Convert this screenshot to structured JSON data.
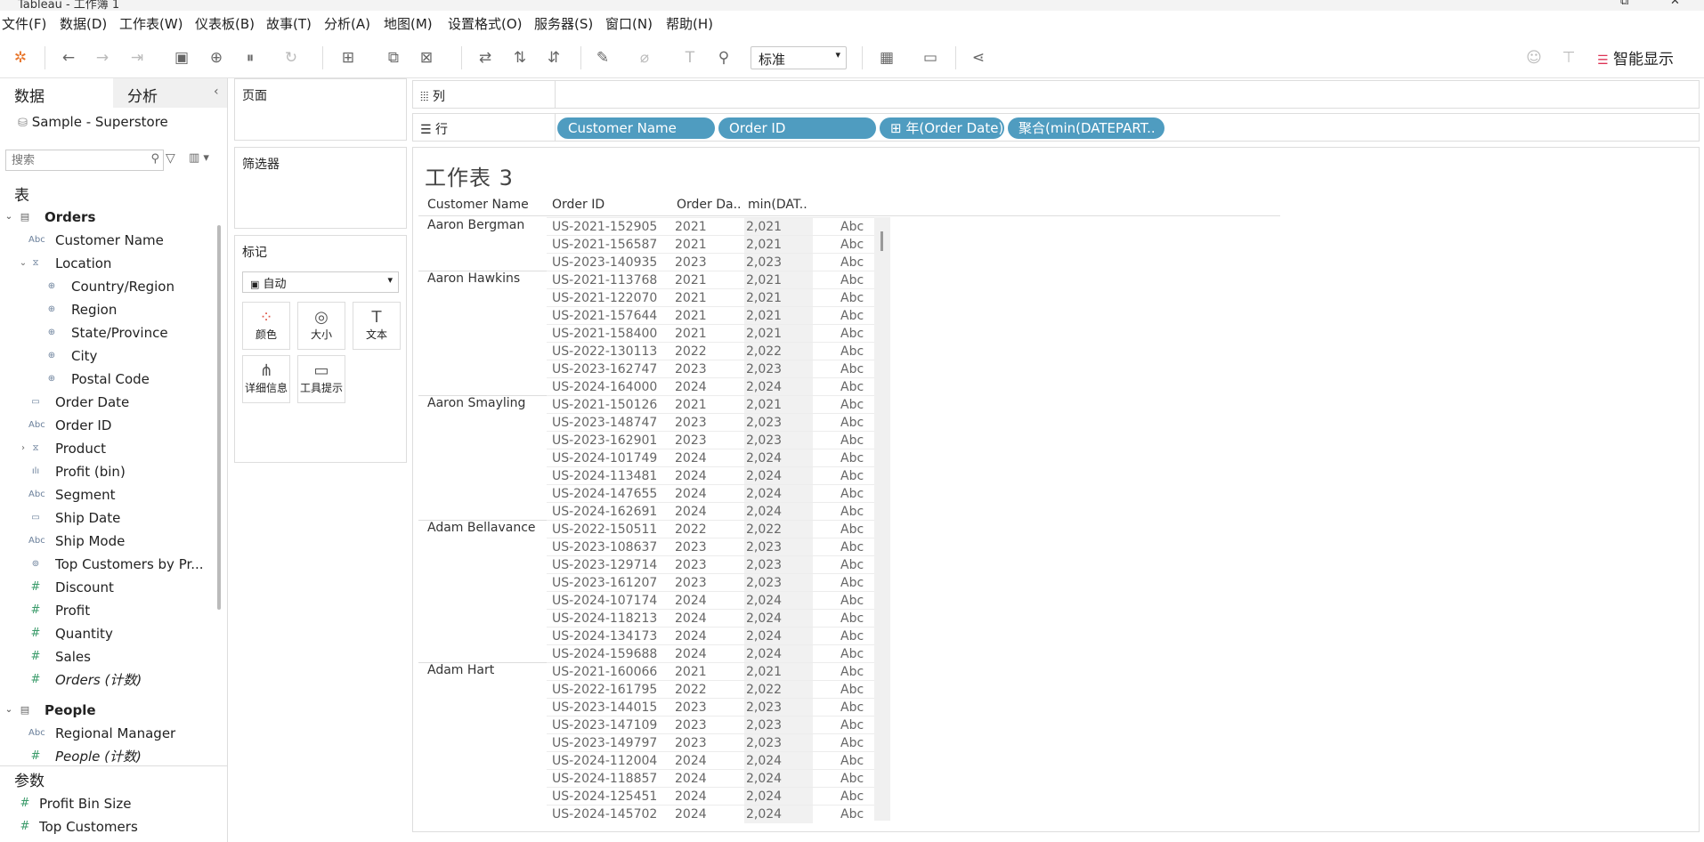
{
  "title": "Tableau - 工作簿 1",
  "menu": [
    "文件(F)",
    "数据(D)",
    "工作表(W)",
    "仪表板(B)",
    "故事(T)",
    "分析(A)",
    "地图(M)",
    "设置格式(O)",
    "服务器(S)",
    "窗口(N)",
    "帮助(H)"
  ],
  "toolbar": {
    "fit_select": "标准",
    "show_me": "智能显示"
  },
  "left_panel": {
    "tab_data": "数据",
    "tab_analysis": "分析",
    "datasource": "Sample - Superstore",
    "search_placeholder": "搜索",
    "tables_header": "表",
    "fields": [
      {
        "label": "Orders",
        "icon": "table-icon",
        "indent": 0,
        "group": true
      },
      {
        "label": "Customer Name",
        "icon": "abc-icon",
        "indent": 1
      },
      {
        "label": "Location",
        "icon": "hierarchy-icon",
        "indent": 1,
        "expand": "v"
      },
      {
        "label": "Country/Region",
        "icon": "globe-icon",
        "indent": 2
      },
      {
        "label": "Region",
        "icon": "globe-icon",
        "indent": 2
      },
      {
        "label": "State/Province",
        "icon": "globe-icon",
        "indent": 2
      },
      {
        "label": "City",
        "icon": "globe-icon",
        "indent": 2
      },
      {
        "label": "Postal Code",
        "icon": "globe-icon",
        "indent": 2
      },
      {
        "label": "Order Date",
        "icon": "calendar-icon",
        "indent": 1
      },
      {
        "label": "Order ID",
        "icon": "abc-icon",
        "indent": 1
      },
      {
        "label": "Product",
        "icon": "hierarchy-icon",
        "indent": 1,
        "expand": ">"
      },
      {
        "label": "Profit (bin)",
        "icon": "bin-icon",
        "indent": 1
      },
      {
        "label": "Segment",
        "icon": "abc-icon",
        "indent": 1
      },
      {
        "label": "Ship Date",
        "icon": "calendar-icon",
        "indent": 1
      },
      {
        "label": "Ship Mode",
        "icon": "abc-icon",
        "indent": 1
      },
      {
        "label": "Top Customers by Pr...",
        "icon": "set-icon",
        "indent": 1
      },
      {
        "label": "Discount",
        "icon": "measure-icon",
        "indent": 1
      },
      {
        "label": "Profit",
        "icon": "measure-icon",
        "indent": 1
      },
      {
        "label": "Quantity",
        "icon": "measure-icon",
        "indent": 1
      },
      {
        "label": "Sales",
        "icon": "measure-icon",
        "indent": 1
      },
      {
        "label": "Orders (计数)",
        "icon": "measure-icon",
        "indent": 1,
        "italic": true
      },
      {
        "label": "People",
        "icon": "table-icon",
        "indent": 0,
        "group": true
      },
      {
        "label": "Regional Manager",
        "icon": "abc-icon",
        "indent": 1
      },
      {
        "label": "People (计数)",
        "icon": "measure-icon",
        "indent": 1,
        "italic": true
      }
    ],
    "params_header": "参数",
    "params": [
      "Profit Bin Size",
      "Top Customers"
    ]
  },
  "cards": {
    "pages": "页面",
    "filters": "筛选器",
    "marks": "标记",
    "mark_type": "自动",
    "buttons": [
      "颜色",
      "大小",
      "文本",
      "详细信息",
      "工具提示"
    ]
  },
  "shelves": {
    "columns_label": "列",
    "rows_label": "行",
    "row_pills": [
      "Customer Name",
      "Order ID",
      "⊞ 年(Order Date)",
      "聚合(min(DATEPART.."
    ]
  },
  "sheet": {
    "title": "工作表 3",
    "headers": [
      "Customer Name",
      "Order ID",
      "Order Da..",
      "min(DAT.."
    ],
    "groups": [
      {
        "customer": "Aaron Bergman",
        "rows": [
          [
            "US-2021-152905",
            "2021",
            "2,021"
          ],
          [
            "US-2021-156587",
            "2021",
            "2,021"
          ],
          [
            "US-2023-140935",
            "2023",
            "2,023"
          ]
        ]
      },
      {
        "customer": "Aaron Hawkins",
        "rows": [
          [
            "US-2021-113768",
            "2021",
            "2,021"
          ],
          [
            "US-2021-122070",
            "2021",
            "2,021"
          ],
          [
            "US-2021-157644",
            "2021",
            "2,021"
          ],
          [
            "US-2021-158400",
            "2021",
            "2,021"
          ],
          [
            "US-2022-130113",
            "2022",
            "2,022"
          ],
          [
            "US-2023-162747",
            "2023",
            "2,023"
          ],
          [
            "US-2024-164000",
            "2024",
            "2,024"
          ]
        ]
      },
      {
        "customer": "Aaron Smayling",
        "rows": [
          [
            "US-2021-150126",
            "2021",
            "2,021"
          ],
          [
            "US-2023-148747",
            "2023",
            "2,023"
          ],
          [
            "US-2023-162901",
            "2023",
            "2,023"
          ],
          [
            "US-2024-101749",
            "2024",
            "2,024"
          ],
          [
            "US-2024-113481",
            "2024",
            "2,024"
          ],
          [
            "US-2024-147655",
            "2024",
            "2,024"
          ],
          [
            "US-2024-162691",
            "2024",
            "2,024"
          ]
        ]
      },
      {
        "customer": "Adam Bellavance",
        "rows": [
          [
            "US-2022-150511",
            "2022",
            "2,022"
          ],
          [
            "US-2023-108637",
            "2023",
            "2,023"
          ],
          [
            "US-2023-129714",
            "2023",
            "2,023"
          ],
          [
            "US-2023-161207",
            "2023",
            "2,023"
          ],
          [
            "US-2024-107174",
            "2024",
            "2,024"
          ],
          [
            "US-2024-118213",
            "2024",
            "2,024"
          ],
          [
            "US-2024-134173",
            "2024",
            "2,024"
          ],
          [
            "US-2024-159688",
            "2024",
            "2,024"
          ]
        ]
      },
      {
        "customer": "Adam Hart",
        "rows": [
          [
            "US-2021-160066",
            "2021",
            "2,021"
          ],
          [
            "US-2022-161795",
            "2022",
            "2,022"
          ],
          [
            "US-2023-144015",
            "2023",
            "2,023"
          ],
          [
            "US-2023-147109",
            "2023",
            "2,023"
          ],
          [
            "US-2023-149797",
            "2023",
            "2,023"
          ],
          [
            "US-2024-112004",
            "2024",
            "2,024"
          ],
          [
            "US-2024-118857",
            "2024",
            "2,024"
          ],
          [
            "US-2024-125451",
            "2024",
            "2,024"
          ],
          [
            "US-2024-145702",
            "2024",
            "2,024"
          ]
        ]
      }
    ],
    "abc": "Abc"
  }
}
